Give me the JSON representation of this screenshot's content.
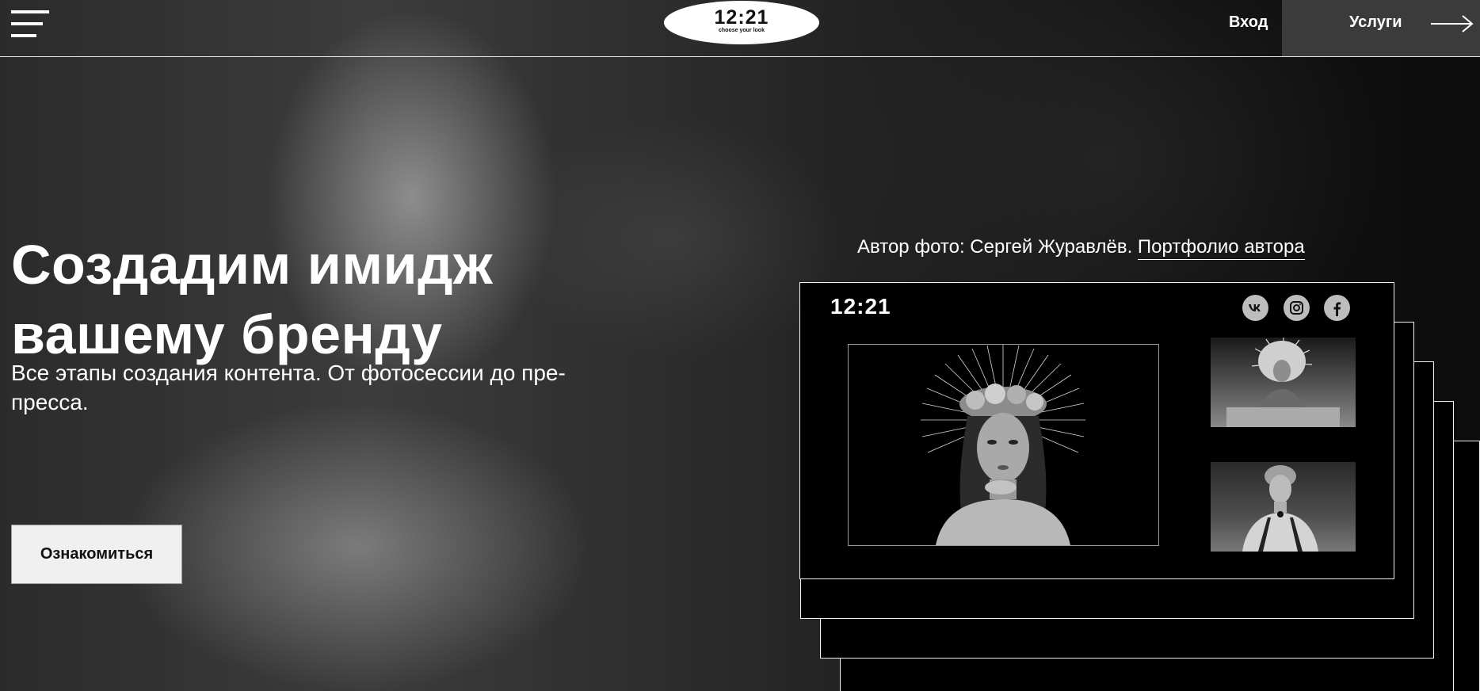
{
  "header": {
    "logo_time": "12:21",
    "logo_tagline": "choose your look",
    "login_label": "Вход",
    "services_label": "Услуги"
  },
  "hero": {
    "title": "Создадим имидж вашему бренду",
    "subtitle": "Все этапы создания контента. От фотосессии до пре-пресса.",
    "cta_label": "Ознакомиться"
  },
  "author": {
    "credit": "Автор фото: Сергей Журавлёв.",
    "portfolio_link": "Портфолио автора"
  },
  "preview": {
    "logo": "12:21",
    "social_icons": [
      "vk-icon",
      "instagram-icon",
      "facebook-icon"
    ]
  },
  "colors": {
    "background": "#000000",
    "text": "#ffffff",
    "services_bg": "#3b3b3b",
    "cta_bg": "#f0f0f0"
  }
}
